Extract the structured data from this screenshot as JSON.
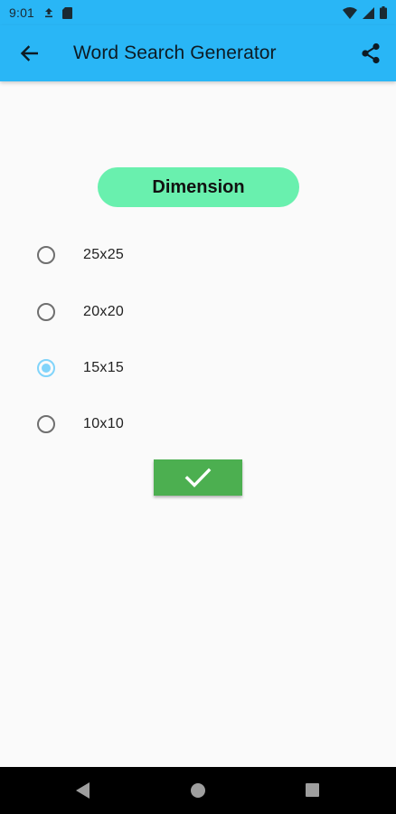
{
  "status_bar": {
    "time": "9:01",
    "icons": [
      "upload-icon",
      "sd-card-icon",
      "wifi-icon",
      "signal-icon",
      "battery-icon"
    ]
  },
  "app_bar": {
    "title": "Word Search Generator",
    "back_icon": "arrow-left-icon",
    "share_icon": "share-icon"
  },
  "dimension": {
    "label": "Dimension",
    "options": [
      {
        "label": "25x25",
        "selected": false
      },
      {
        "label": "20x20",
        "selected": false
      },
      {
        "label": "15x15",
        "selected": true
      },
      {
        "label": "10x10",
        "selected": false
      }
    ],
    "confirm_icon": "check-icon"
  },
  "colors": {
    "app_bar": "#29b6f6",
    "pill": "#69f0ae",
    "confirm": "#4caf50",
    "radio_selected": "#81d4fa"
  },
  "nav_bar": {
    "icons": [
      "nav-back-icon",
      "nav-home-icon",
      "nav-recents-icon"
    ]
  }
}
